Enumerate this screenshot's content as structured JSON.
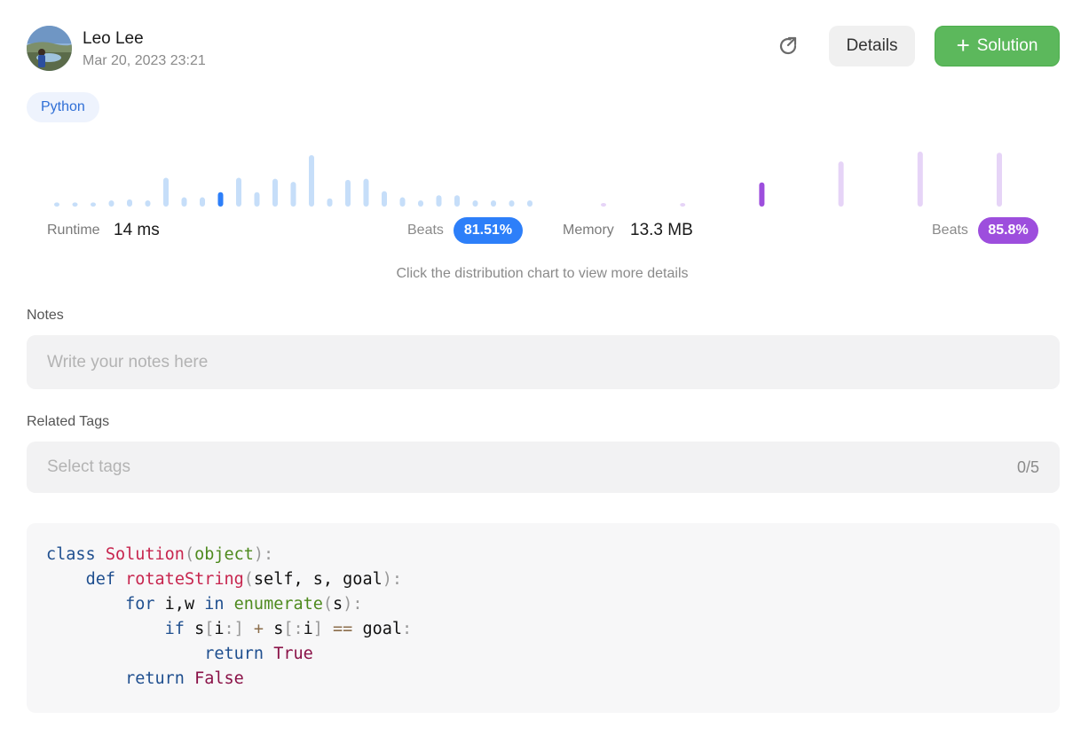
{
  "user": {
    "name": "Leo Lee",
    "timestamp": "Mar 20, 2023 23:21"
  },
  "header": {
    "details_label": "Details",
    "solution_label": "Solution",
    "reset_icon": "external-refresh-icon",
    "plus_icon": "plus-icon"
  },
  "language": "Python",
  "runtime": {
    "label": "Runtime",
    "value": "14 ms",
    "beats_label": "Beats",
    "beats_value": "81.51%",
    "accent": "#2d7ff9",
    "light": "#c6def9",
    "bars": [
      0.08,
      0.08,
      0.08,
      0.12,
      0.14,
      0.12,
      0.56,
      0.18,
      0.18,
      0.28,
      0.56,
      0.28,
      0.54,
      0.48,
      1.0,
      0.16,
      0.52,
      0.54,
      0.3,
      0.18,
      0.12,
      0.22,
      0.22,
      0.12,
      0.12,
      0.12,
      0.12
    ],
    "selected_index": 9
  },
  "memory": {
    "label": "Memory",
    "value": "13.3 MB",
    "beats_label": "Beats",
    "beats_value": "85.8%",
    "accent": "#9d4edd",
    "light": "#e6d4f7",
    "bars": [
      0.06,
      0.06,
      0.44,
      0.82,
      1.0,
      0.98
    ],
    "selected_index": 2
  },
  "chart_hint": "Click the distribution chart to view more details",
  "notes": {
    "label": "Notes",
    "placeholder": "Write your notes here"
  },
  "tags": {
    "label": "Related Tags",
    "placeholder": "Select tags",
    "count": "0/5"
  },
  "code": {
    "language": "python",
    "lines": [
      [
        [
          "kw",
          "class "
        ],
        [
          "cls",
          "Solution"
        ],
        [
          "punc",
          "("
        ],
        [
          "bi",
          "object"
        ],
        [
          "punc",
          "):"
        ]
      ],
      [
        [
          "var",
          "    "
        ],
        [
          "kw",
          "def "
        ],
        [
          "fn",
          "rotateString"
        ],
        [
          "punc",
          "("
        ],
        [
          "var",
          "self, s, goal"
        ],
        [
          "punc",
          "):"
        ]
      ],
      [
        [
          "var",
          "        "
        ],
        [
          "kw",
          "for "
        ],
        [
          "var",
          "i,w "
        ],
        [
          "kw",
          "in "
        ],
        [
          "bi",
          "enumerate"
        ],
        [
          "punc",
          "("
        ],
        [
          "var",
          "s"
        ],
        [
          "punc",
          "):"
        ]
      ],
      [
        [
          "var",
          "            "
        ],
        [
          "kw",
          "if "
        ],
        [
          "var",
          "s"
        ],
        [
          "punc",
          "["
        ],
        [
          "var",
          "i"
        ],
        [
          "punc",
          ":]"
        ],
        [
          "op",
          " + "
        ],
        [
          "var",
          "s"
        ],
        [
          "punc",
          "[:"
        ],
        [
          "var",
          "i"
        ],
        [
          "punc",
          "]"
        ],
        [
          "op",
          " == "
        ],
        [
          "var",
          "goal"
        ],
        [
          "punc",
          ":"
        ]
      ],
      [
        [
          "var",
          "                "
        ],
        [
          "kw",
          "return "
        ],
        [
          "const",
          "True"
        ]
      ],
      [
        [
          "var",
          "        "
        ],
        [
          "kw",
          "return "
        ],
        [
          "const",
          "False"
        ]
      ]
    ]
  }
}
